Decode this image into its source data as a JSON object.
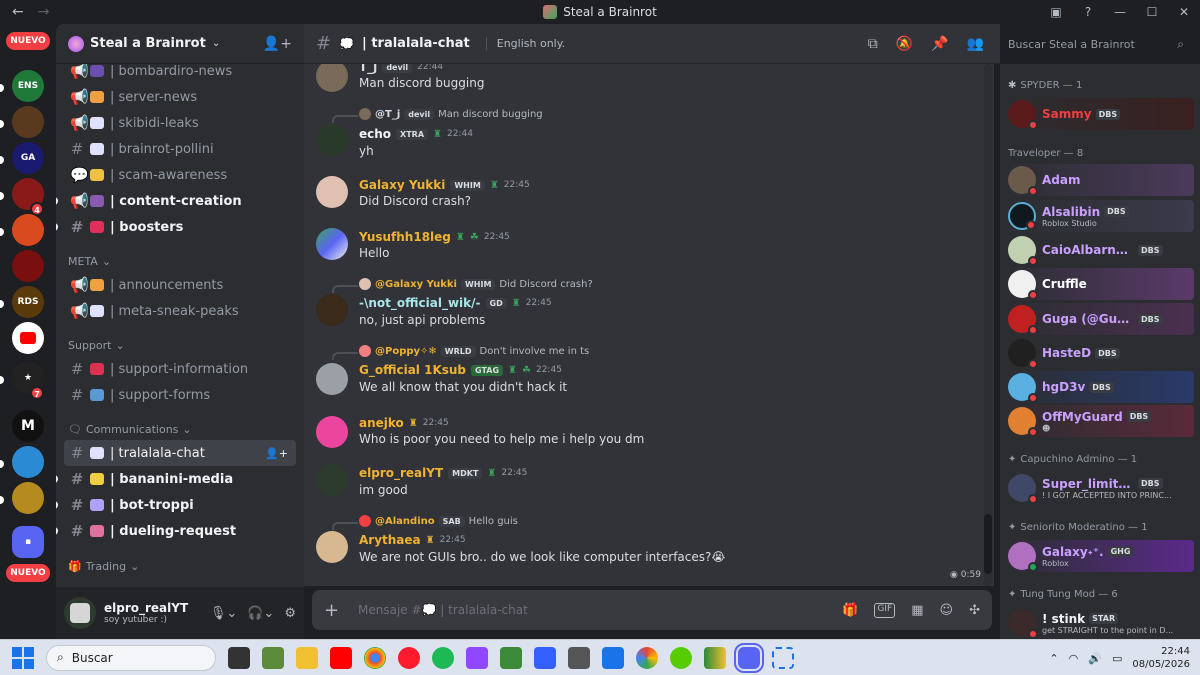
{
  "window": {
    "title": "Steal a Brainrot",
    "nav_back": "←",
    "nav_fwd": "→"
  },
  "rail": {
    "new_badge": "NUEVO",
    "badge_4": "4",
    "badge_7": "7"
  },
  "guild": {
    "name": "Steal a Brainrot"
  },
  "channels": {
    "items": [
      {
        "name": "| bombardiro-news",
        "kind": "announce"
      },
      {
        "name": "| server-news",
        "kind": "announce"
      },
      {
        "name": "| skibidi-leaks",
        "kind": "announce"
      },
      {
        "name": "| brainrot-pollini",
        "kind": "text"
      },
      {
        "name": "| scam-awareness",
        "kind": "forum"
      },
      {
        "name": "| content-creation",
        "kind": "announce"
      },
      {
        "name": "| boosters",
        "kind": "text"
      },
      {
        "name": "| announcements",
        "kind": "announce"
      },
      {
        "name": "| meta-sneak-peaks",
        "kind": "announce"
      },
      {
        "name": "| support-information",
        "kind": "text"
      },
      {
        "name": "| support-forms",
        "kind": "text"
      },
      {
        "name": "| tralalala-chat",
        "kind": "text"
      },
      {
        "name": "| bananini-media",
        "kind": "text"
      },
      {
        "name": "| bot-troppi",
        "kind": "text"
      },
      {
        "name": "| dueling-request",
        "kind": "text"
      }
    ],
    "categories": {
      "meta": "META",
      "support": "Support",
      "communications": "Communications",
      "trading": "Trading"
    }
  },
  "user_panel": {
    "name": "elpro_realYT",
    "status": "soy yutuber :)"
  },
  "chat": {
    "channel": "| tralalala-chat",
    "topic": "English only.",
    "search_placeholder": "Buscar Steal a Brainrot",
    "composer_placeholder": "Mensaje #💭 | tralalala-chat",
    "voice_time": "0:59"
  },
  "messages": [
    {
      "user": "T_j",
      "tag": "devil",
      "time": "22:44",
      "text": "Man discord bugging",
      "color": "#dbdee1"
    },
    {
      "reply_to": "@T_j",
      "reply_tag": "devil",
      "reply_text": "Man discord bugging",
      "user": "echo",
      "tag": "XTRA",
      "time": "22:44",
      "text": "yh",
      "color": "#f0b232"
    },
    {
      "user": "Galaxy Yukki",
      "tag": "WHIM",
      "time": "22:45",
      "text": "Did Discord crash?",
      "color": "#f0b232"
    },
    {
      "user": "Yusufhh18leg",
      "tag": "",
      "time": "22:45",
      "text": "Hello",
      "color": "#f0b232"
    },
    {
      "reply_to": "@Galaxy Yukki",
      "reply_tag": "WHIM",
      "reply_text": "Did Discord crash?",
      "user": "-\\not_official_wik/-",
      "tag": "GD",
      "time": "22:45",
      "text": "no, just api problems",
      "color": "#a8e6e9"
    },
    {
      "reply_to": "@Poppy✧❄",
      "reply_tag": "WRLD",
      "reply_text": "Don't involve me in ts",
      "user": "G_official 1Ksub",
      "tag": "GTAG",
      "time": "22:45",
      "text": "We all know that you didn't hack it",
      "color": "#f0b232"
    },
    {
      "user": "anejko",
      "tag": "",
      "time": "22:45",
      "text": "Who is poor you need to help me i help you dm",
      "color": "#f0b232"
    },
    {
      "user": "elpro_realYT",
      "tag": "MDKT",
      "time": "22:45",
      "text": "im good",
      "color": "#f0b232"
    },
    {
      "reply_to": "@Alandino",
      "reply_tag": "SAB",
      "reply_text": "Hello guis",
      "user": "Arythaea",
      "tag": "",
      "time": "22:45",
      "text": "We are not GUIs bro.. do we look like computer interfaces?😭",
      "color": "#f0b232"
    }
  ],
  "members": {
    "roles": [
      "SPYDER — 1",
      "Traveloper — 8",
      "Capuchino Admino — 1",
      "Seniorito Moderatino — 1",
      "Tung Tung Mod — 6"
    ],
    "list": [
      {
        "name": "Sammy",
        "tag": "DBS",
        "sub": "",
        "color": "#f23f43"
      },
      {
        "name": "Adam",
        "tag": "",
        "sub": "",
        "color": "#c9a0ff"
      },
      {
        "name": "Alsalibin",
        "tag": "DBS",
        "sub": "Roblox Studio",
        "color": "#c9a0ff"
      },
      {
        "name": "CaioAlbarnBR",
        "tag": "DBS",
        "sub": "",
        "color": "#c9a0ff"
      },
      {
        "name": "Cruffle",
        "tag": "",
        "sub": "",
        "color": "#ffffff"
      },
      {
        "name": "Guga (@Gug...",
        "tag": "DBS",
        "sub": "",
        "color": "#c9a0ff"
      },
      {
        "name": "HasteD",
        "tag": "DBS",
        "sub": "",
        "color": "#c9a0ff"
      },
      {
        "name": "hgD3v",
        "tag": "DBS",
        "sub": "",
        "color": "#c9a0ff"
      },
      {
        "name": "OffMyGuard",
        "tag": "DBS",
        "sub": "",
        "color": "#c9a0ff"
      },
      {
        "name": "Super_limited",
        "tag": "DBS",
        "sub": "! I GOT ACCEPTED INTO PRINC...",
        "color": "#c9a0ff"
      },
      {
        "name": "Galaxy˖⁺.",
        "tag": "GHG",
        "sub": "Roblox",
        "color": "#c9a0ff"
      },
      {
        "name": "! stink",
        "tag": "STAR",
        "sub": "get STRAIGHT to the point in D...",
        "color": "#f2f3f5"
      }
    ]
  },
  "taskbar": {
    "search": "Buscar",
    "time": "22:44",
    "date": "08/05/2026"
  }
}
